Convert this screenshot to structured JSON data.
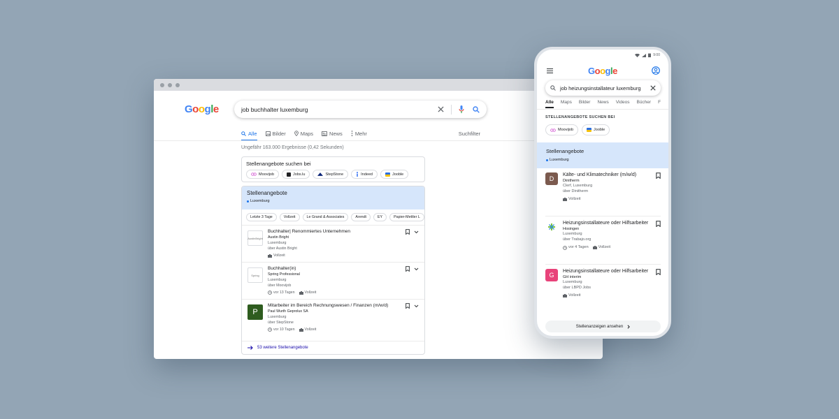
{
  "desktop": {
    "logo": "Google",
    "search": {
      "query": "job buchhalter luxemburg"
    },
    "tabs": [
      {
        "label": "Alle",
        "icon": "search-icon"
      },
      {
        "label": "Bilder",
        "icon": "image-icon"
      },
      {
        "label": "Maps",
        "icon": "map-pin-icon"
      },
      {
        "label": "News",
        "icon": "news-icon"
      },
      {
        "label": "Mehr",
        "icon": "more-vertical-icon"
      }
    ],
    "search_filter": "Suchfilter",
    "result_count": "Ungefähr 163.000 Ergebnisse (0,42 Sekunden)",
    "providers": {
      "title": "Stellenangebote suchen bei",
      "items": [
        {
          "label": "Moovijob",
          "color": "#d04fd0"
        },
        {
          "label": "Jobs.lu",
          "color": "#202124"
        },
        {
          "label": "StepStone",
          "color": "#0c2577"
        },
        {
          "label": "Indeed",
          "color": "#2164f3"
        },
        {
          "label": "Jooble",
          "color": "#2a6ee0"
        }
      ]
    },
    "jobs": {
      "title": "Stellenangebote",
      "location": "Luxemburg",
      "filters": [
        "Letzte 3 Tage",
        "Vollzeit",
        "Le Grand & Associates",
        "Arendt",
        "EY",
        "Papier-Mettler L"
      ],
      "items": [
        {
          "title": "Buchhalter| Renommiertes Unternehmen",
          "company": "Austin Bright",
          "location": "Luxemburg",
          "via": "über Austin Bright",
          "age": "",
          "type": "Vollzeit",
          "logo_text": "AustinBright"
        },
        {
          "title": "Buchhalter(in)",
          "company": "Spring Professional",
          "location": "Luxemburg",
          "via": "über Moovijob",
          "age": "vor 13 Tagen",
          "type": "Vollzeit",
          "logo_text": "Spring"
        },
        {
          "title": "Mitarbeiter im Bereich Rechnungswesen / Finanzen (m/w/d)",
          "company": "Paul Wurth Geprolux SA",
          "location": "Luxemburg",
          "via": "über StepStone",
          "age": "vor 10 Tagen",
          "type": "Vollzeit",
          "logo_text": "P"
        }
      ],
      "more": "53 weitere Stellenangebote"
    }
  },
  "mobile": {
    "status_time": "9:00",
    "logo": "Google",
    "search": {
      "query": "job heizungsinstallateur luxemburg"
    },
    "tabs": [
      "Alle",
      "Maps",
      "Bilder",
      "News",
      "Videos",
      "Bücher",
      "F"
    ],
    "providers_label": "STELLENANGEBOTE SUCHEN BEI",
    "providers": [
      {
        "label": "Moovijob",
        "color": "#d04fd0"
      },
      {
        "label": "Jooble",
        "color": "#2a6ee0"
      }
    ],
    "jobs_title": "Stellenangebote",
    "jobs_location": "Luxemburg",
    "jobs": [
      {
        "logo": "D",
        "logo_color": "#7b5a4e",
        "title": "Kälte- und Klimatechniker (m/w/d)",
        "company": "Dinitherm",
        "location": "Clerf, Luxemburg",
        "via": "über Dinitherm",
        "age": "",
        "type": "Vollzeit"
      },
      {
        "logo": "",
        "logo_color": "#ffffff",
        "title": "Heizungsinstallateure oder Hilfsarbeiter",
        "company": "Hosingen",
        "location": "Luxemburg",
        "via": "über Trabajo.org",
        "age": "vor 4 Tagen",
        "type": "Vollzeit"
      },
      {
        "logo": "G",
        "logo_color": "#e8437a",
        "title": "Heizungsinstallateure oder Hilfsarbeiter",
        "company": "GH interim",
        "location": "Luxemburg",
        "via": "über LBPD Jobs",
        "age": "",
        "type": "Vollzeit"
      }
    ],
    "more": "Stellenanzeigen ansehen"
  }
}
